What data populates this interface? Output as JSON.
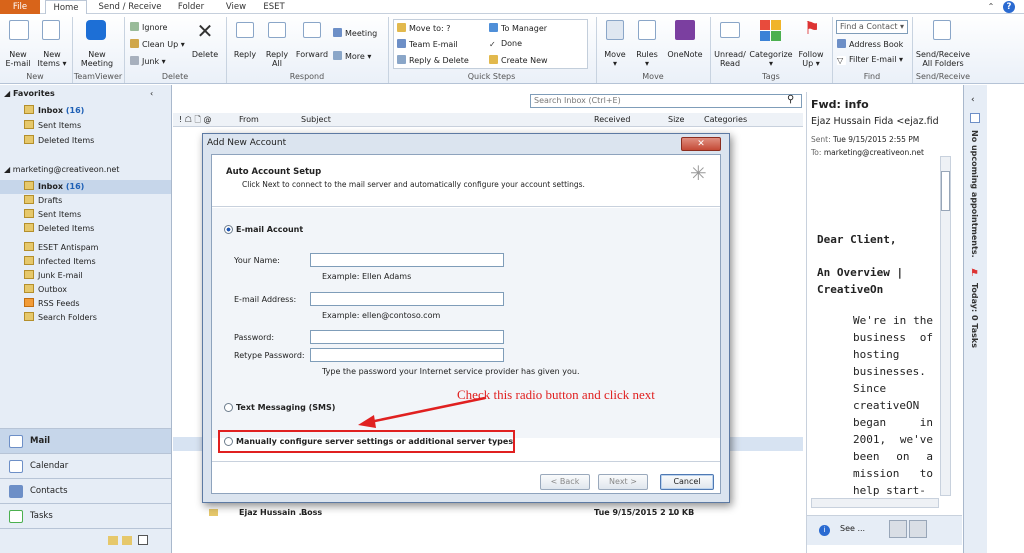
{
  "tabs": {
    "file": "File",
    "home": "Home",
    "send_receive": "Send / Receive",
    "folder": "Folder",
    "view": "View",
    "eset": "ESET"
  },
  "ribbon": {
    "new_email": "New\nE-mail",
    "new_items": "New\nItems ▾",
    "new_meeting": "New\nMeeting",
    "ignore": "Ignore",
    "clean_up": "Clean Up ▾",
    "junk": "Junk ▾",
    "delete": "Delete",
    "reply": "Reply",
    "reply_all": "Reply\nAll",
    "forward": "Forward",
    "meeting": "Meeting",
    "more": "More ▾",
    "qs_move_to": "Move to: ?",
    "qs_team_email": "Team E-mail",
    "qs_reply_delete": "Reply & Delete",
    "qs_to_manager": "To Manager",
    "qs_done": "Done",
    "qs_create_new": "Create New",
    "move": "Move\n▾",
    "rules": "Rules\n▾",
    "onenote": "OneNote",
    "unread_read": "Unread/\nRead",
    "categorize": "Categorize\n▾",
    "follow_up": "Follow\nUp ▾",
    "find_contact": "Find a Contact ▾",
    "address_book": "Address Book",
    "filter_email": "Filter E-mail ▾",
    "send_receive_all": "Send/Receive\nAll Folders",
    "groups": {
      "new": "New",
      "teamviewer": "TeamViewer",
      "delete": "Delete",
      "respond": "Respond",
      "quick_steps": "Quick Steps",
      "move": "Move",
      "tags": "Tags",
      "find": "Find",
      "send_receive": "Send/Receive"
    }
  },
  "nav": {
    "favorites": "◢ Favorites",
    "inbox_fav": "Inbox",
    "inbox_fav_count": "(16)",
    "sent_fav": "Sent Items",
    "deleted_fav": "Deleted Items",
    "account": "◢ marketing@creativeon.net",
    "folders": [
      {
        "label": "Inbox",
        "count": "(16)"
      },
      {
        "label": "Drafts"
      },
      {
        "label": "Sent Items"
      },
      {
        "label": "Deleted Items"
      },
      {
        "label": "ESET Antispam"
      },
      {
        "label": "Infected Items"
      },
      {
        "label": "Junk E-mail"
      },
      {
        "label": "Outbox"
      },
      {
        "label": "RSS Feeds"
      },
      {
        "label": "Search Folders"
      }
    ],
    "mail": "Mail",
    "calendar": "Calendar",
    "contacts": "Contacts",
    "tasks": "Tasks"
  },
  "list": {
    "search_placeholder": "Search Inbox (Ctrl+E)",
    "col_icons": "! ☖ 🗋 @",
    "col_from": "From",
    "col_subject": "Subject",
    "col_received": "Received",
    "col_size": "Size",
    "col_categories": "Categories",
    "last_from": "Ejaz Hussain ...",
    "last_subject": "Boss",
    "last_received": "Tue 9/15/2015 2 ...",
    "last_size": "10 KB"
  },
  "reading": {
    "title": "Fwd: info",
    "from": "Ejaz Hussain Fida <ejaz.fid",
    "sent_label": "Sent:",
    "sent_value": "Tue 9/15/2015 2:55 PM",
    "to_label": "To:",
    "to_value": "marketing@creativeon.net",
    "greeting": "Dear Client,",
    "overview": "An Overview | CreativeOn",
    "body": "We're in the business of hosting businesses. Since creativeON began in 2001, we've been on a mission to help start-",
    "see_more": "See ..."
  },
  "todo": {
    "appointments": "No upcoming appointments.",
    "tasks": "Today: 0 Tasks"
  },
  "dialog": {
    "title": "Add New Account",
    "close": "✕",
    "header_title": "Auto Account Setup",
    "header_desc": "Click Next to connect to the mail server and automatically configure your account settings.",
    "email_account": "E-mail Account",
    "your_name": "Your Name:",
    "name_example": "Example: Ellen Adams",
    "email_address": "E-mail Address:",
    "email_example": "Example: ellen@contoso.com",
    "password": "Password:",
    "retype_password": "Retype Password:",
    "password_hint": "Type the password your Internet service provider has given you.",
    "text_messaging": "Text Messaging (SMS)",
    "manual_config": "Manually configure server settings or additional server types",
    "back": "< Back",
    "next": "Next >",
    "cancel": "Cancel"
  },
  "annotation": "Check this radio button and click next",
  "colors": {
    "accent": "#d8641a",
    "annotation": "#e02020",
    "ribbon_bg": "#eaf0f8",
    "nav_bg": "#e6edf6"
  }
}
